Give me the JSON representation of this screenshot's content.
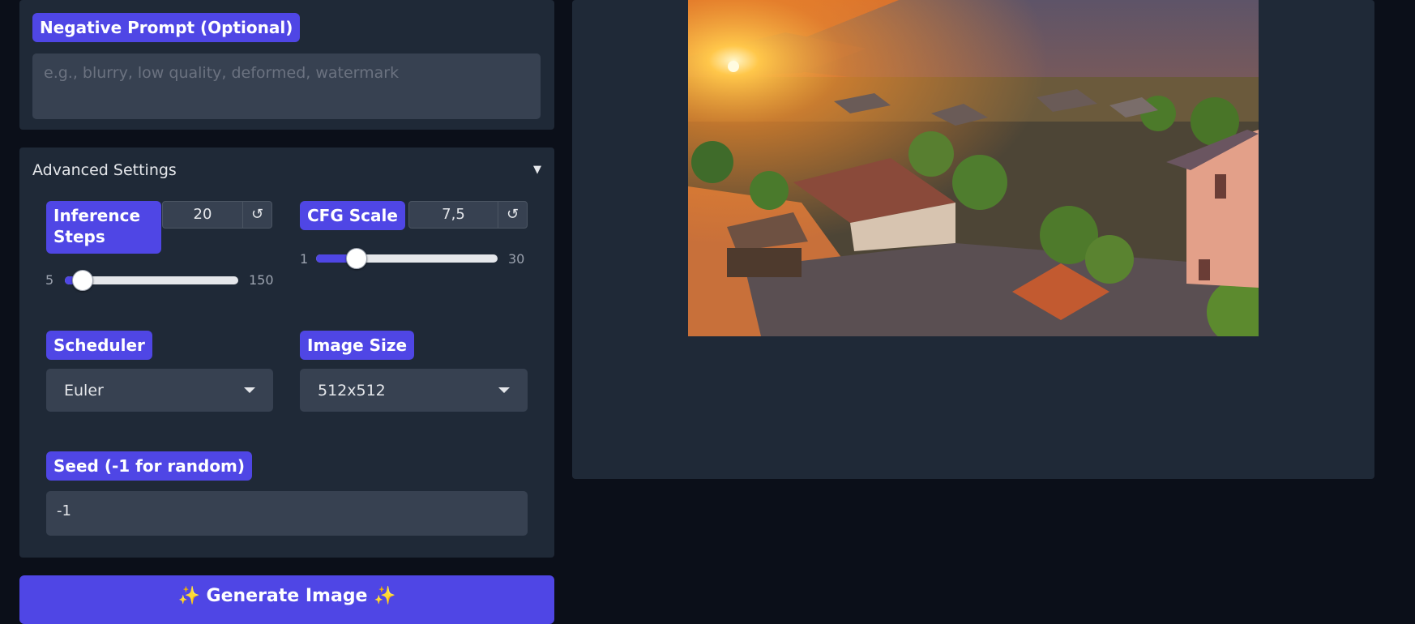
{
  "negative_prompt": {
    "label": "Negative Prompt (Optional)",
    "placeholder": "e.g., blurry, low quality, deformed, watermark",
    "value": ""
  },
  "advanced": {
    "title": "Advanced Settings",
    "toggle_icon": "▼",
    "inference_steps": {
      "label": "Inference Steps",
      "value": "20",
      "min": "5",
      "max": "150",
      "reset_icon": "↺",
      "fraction": 0.103
    },
    "cfg_scale": {
      "label": "CFG Scale",
      "value": "7,5",
      "min": "1",
      "max": "30",
      "reset_icon": "↺",
      "fraction": 0.224
    },
    "scheduler": {
      "label": "Scheduler",
      "selected": "Euler"
    },
    "image_size": {
      "label": "Image Size",
      "selected": "512x512"
    },
    "seed": {
      "label": "Seed (-1 for random)",
      "value": "-1"
    }
  },
  "generate_button": {
    "label": "✨ Generate Image ✨"
  },
  "output": {
    "image_alt": "generated-landscape-image"
  },
  "colors": {
    "accent": "#4f46e5",
    "panel": "#1f2937",
    "background": "#0b0f19",
    "input": "#374151"
  }
}
